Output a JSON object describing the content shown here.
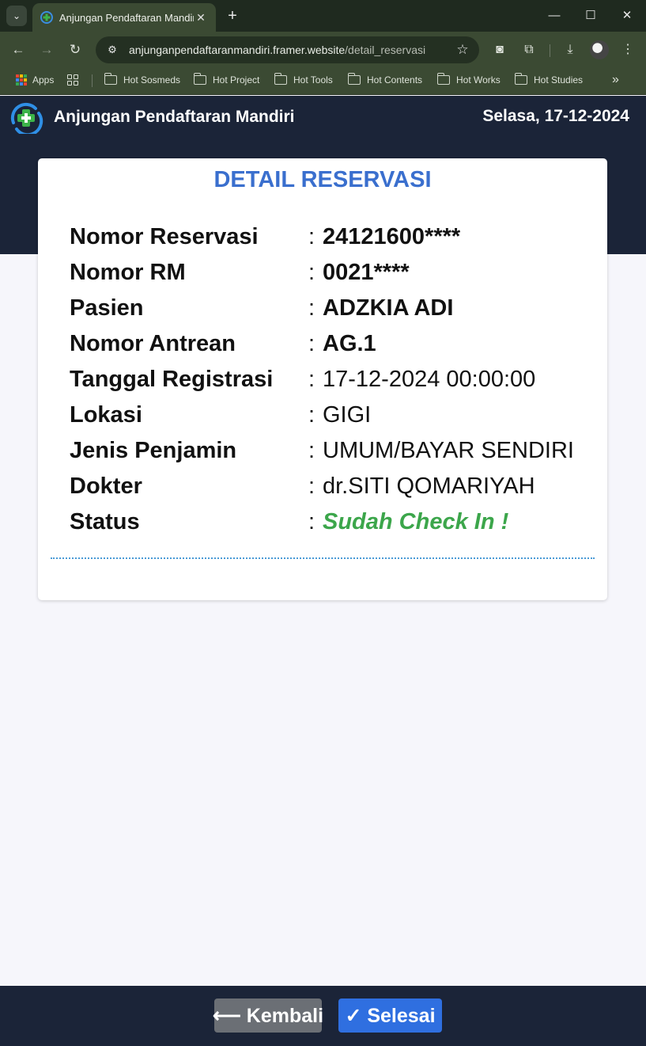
{
  "browser": {
    "tab_title": "Anjungan Pendaftaran Mandiri",
    "tab_close": "✕",
    "new_tab": "+",
    "url_host": "anjunganpendaftaranmandiri.framer.website",
    "url_path": "/detail_reservasi",
    "icons": [
      "tab-list-icon",
      "back-arrow-icon",
      "forward-arrow-icon",
      "reload-icon",
      "site-info-icon",
      "bookmark-star-icon",
      "camera-icon",
      "extensions-icon",
      "download-icon",
      "profile-avatar",
      "menu-kebab-icon",
      "minimize-icon",
      "maximize-icon",
      "close-icon"
    ],
    "bookmarks": {
      "apps": "Apps",
      "items": [
        "Hot Sosmeds",
        "Hot Project",
        "Hot Tools",
        "Hot Contents",
        "Hot Works",
        "Hot Studies"
      ],
      "overflow": "»"
    }
  },
  "page": {
    "app_title": "Anjungan Pendaftaran Mandiri",
    "date": "Selasa, 17-12-2024",
    "card_title": "DETAIL RESERVASI",
    "rows": [
      {
        "label": "Nomor Reservasi",
        "value": "24121600****"
      },
      {
        "label": "Nomor RM",
        "value": "0021****"
      },
      {
        "label": "Pasien",
        "value": "ADZKIA ADI"
      },
      {
        "label": "Nomor Antrean",
        "value": "AG.1"
      },
      {
        "label": "Tanggal Registrasi",
        "value": "17-12-2024 00:00:00"
      },
      {
        "label": "Lokasi",
        "value": "GIGI"
      },
      {
        "label": "Jenis Penjamin",
        "value": "UMUM/BAYAR SENDIRI"
      },
      {
        "label": "Dokter",
        "value": "dr.SITI QOMARIYAH"
      },
      {
        "label": "Status",
        "value": "Sudah Check In !"
      }
    ],
    "colon": ":",
    "buttons": {
      "back": "⟵ Kembali",
      "done": "✓ Selesai"
    }
  },
  "colors": {
    "header_bg": "#1b2438",
    "title_blue": "#3a6fce",
    "status_green": "#3ca64b",
    "back_button": "#6b6f75",
    "done_button": "#2f6fe0"
  }
}
